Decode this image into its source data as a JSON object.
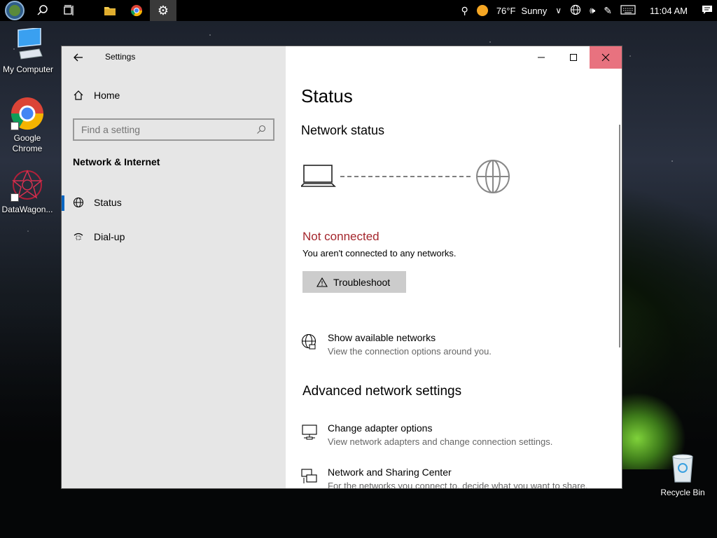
{
  "taskbar": {
    "weather_temp": "76°F",
    "weather_text": "Sunny",
    "clock": "11:04 AM"
  },
  "desktop": {
    "icons": [
      {
        "label": "My Computer"
      },
      {
        "label": "Google Chrome"
      },
      {
        "label": "DataWagon..."
      },
      {
        "label": "Recycle Bin"
      }
    ]
  },
  "window": {
    "title": "Settings",
    "sidebar": {
      "home_label": "Home",
      "search_placeholder": "Find a setting",
      "section_title": "Network & Internet",
      "items": [
        {
          "label": "Status",
          "selected": true
        },
        {
          "label": "Dial-up",
          "selected": false
        }
      ]
    },
    "main": {
      "page_title": "Status",
      "network_status_heading": "Network status",
      "status_text": "Not connected",
      "status_description": "You aren't connected to any networks.",
      "troubleshoot_label": "Troubleshoot",
      "show_networks": {
        "title": "Show available networks",
        "subtitle": "View the connection options around you."
      },
      "advanced_heading": "Advanced network settings",
      "change_adapter": {
        "title": "Change adapter options",
        "subtitle": "View network adapters and change connection settings."
      },
      "sharing_center": {
        "title": "Network and Sharing Center",
        "subtitle": "For the networks you connect to, decide what you want to share."
      }
    }
  },
  "colors": {
    "status_red": "#a4262c",
    "close_hover": "#e8727f",
    "accent": "#0a66c2"
  }
}
